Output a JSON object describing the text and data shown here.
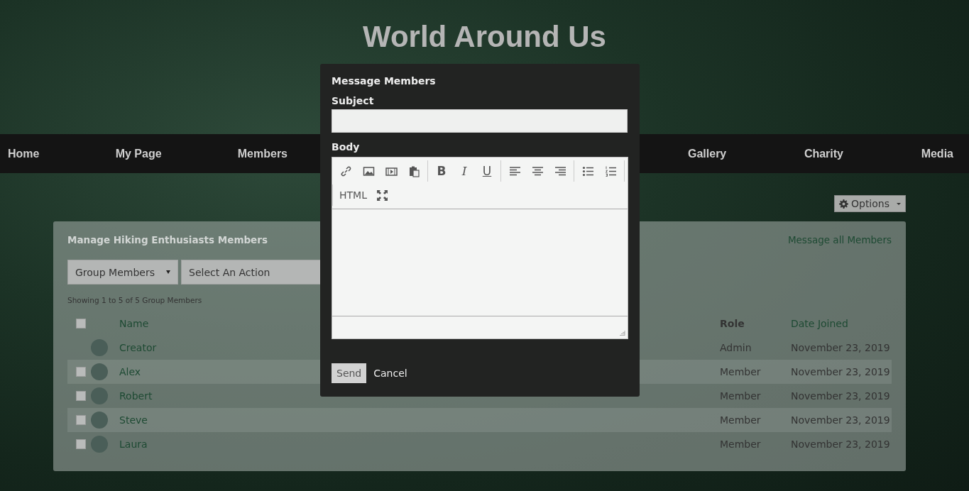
{
  "site_title": "World Around Us",
  "nav": {
    "left": [
      {
        "label": "Home"
      },
      {
        "label": "My Page"
      },
      {
        "label": "Members"
      }
    ],
    "right": [
      {
        "label": "Gallery"
      },
      {
        "label": "Charity"
      },
      {
        "label": "Media"
      }
    ]
  },
  "options_button": {
    "label": "Options"
  },
  "panel": {
    "title": "Manage Hiking Enthusiasts Members",
    "message_link": "Message all Members",
    "filter_select": {
      "value": "Group Members"
    },
    "action_select": {
      "value": "Select An Action"
    },
    "summary": "Showing 1 to 5 of 5 Group Members",
    "table": {
      "header": {
        "checked": false,
        "name": "Name",
        "role": "Role",
        "date": "Date Joined"
      },
      "rows": [
        {
          "name": "Creator",
          "role": "Admin",
          "date": "November 23, 2019"
        },
        {
          "name": "Alex",
          "role": "Member",
          "date": "November 23, 2019",
          "checked": false
        },
        {
          "name": "Robert",
          "role": "Member",
          "date": "November 23, 2019",
          "checked": false
        },
        {
          "name": "Steve",
          "role": "Member",
          "date": "November 23, 2019",
          "checked": false
        },
        {
          "name": "Laura",
          "role": "Member",
          "date": "November 23, 2019",
          "checked": false
        }
      ]
    }
  },
  "dialog": {
    "title": "Message Members",
    "subject_label": "Subject",
    "body_label": "Body",
    "toolbar": [
      [
        {
          "kind": "link"
        },
        {
          "kind": "image"
        },
        {
          "kind": "media"
        },
        {
          "kind": "paste"
        }
      ],
      [
        {
          "kind": "bold",
          "label": "B"
        },
        {
          "kind": "italic",
          "label": "I"
        },
        {
          "kind": "underline",
          "label": "U"
        }
      ],
      [
        {
          "kind": "align-left"
        },
        {
          "kind": "align-center"
        },
        {
          "kind": "align-right"
        }
      ],
      [
        {
          "kind": "bullets"
        },
        {
          "kind": "numbers"
        }
      ],
      [
        {
          "kind": "text",
          "label": "HTML"
        },
        {
          "kind": "fullscreen"
        }
      ]
    ],
    "buttons": [
      {
        "kind": "primary",
        "label": "Send"
      },
      {
        "kind": "plain",
        "label": "Cancel"
      }
    ]
  }
}
